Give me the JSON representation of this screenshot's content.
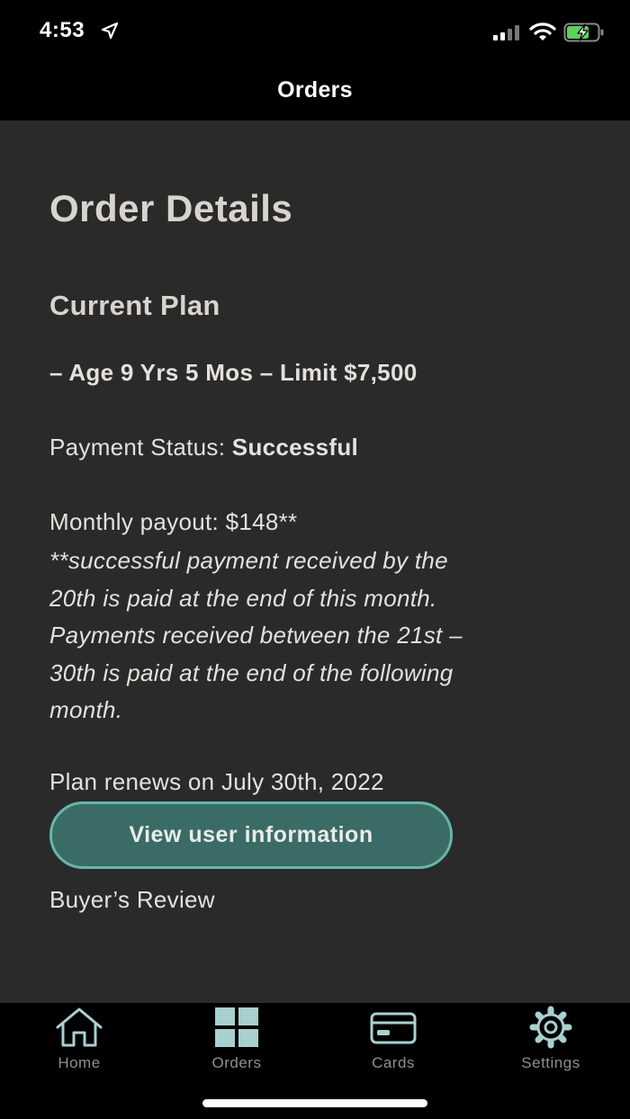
{
  "status_bar": {
    "time": "4:53"
  },
  "nav": {
    "title": "Orders"
  },
  "page": {
    "title": "Order Details",
    "section_title": "Current Plan",
    "plan_summary": "– Age 9 Yrs 5 Mos – Limit $7,500",
    "payment_status_label": "Payment Status:",
    "payment_status_value": "Successful",
    "monthly_payout": "Monthly payout: $148**",
    "payout_note_lines": [
      "**successful payment received by the",
      "20th is paid at the end of this month.",
      "Payments received between the 21st –",
      "30th is paid at the end of the following",
      "month."
    ],
    "renewal": "Plan renews on July 30th, 2022",
    "view_user_button": "View user information",
    "buyers_review": "Buyer’s Review"
  },
  "tabs": [
    {
      "label": "Home",
      "icon": "home-icon"
    },
    {
      "label": "Orders",
      "icon": "grid-icon"
    },
    {
      "label": "Cards",
      "icon": "card-icon"
    },
    {
      "label": "Settings",
      "icon": "gear-icon"
    }
  ],
  "colors": {
    "background": "#2a2a2a",
    "bar_background": "#000000",
    "button_fill": "#3b6b66",
    "button_border": "#66b6aa",
    "tab_icon": "#a8d0d0",
    "battery_green": "#5bd15b"
  }
}
